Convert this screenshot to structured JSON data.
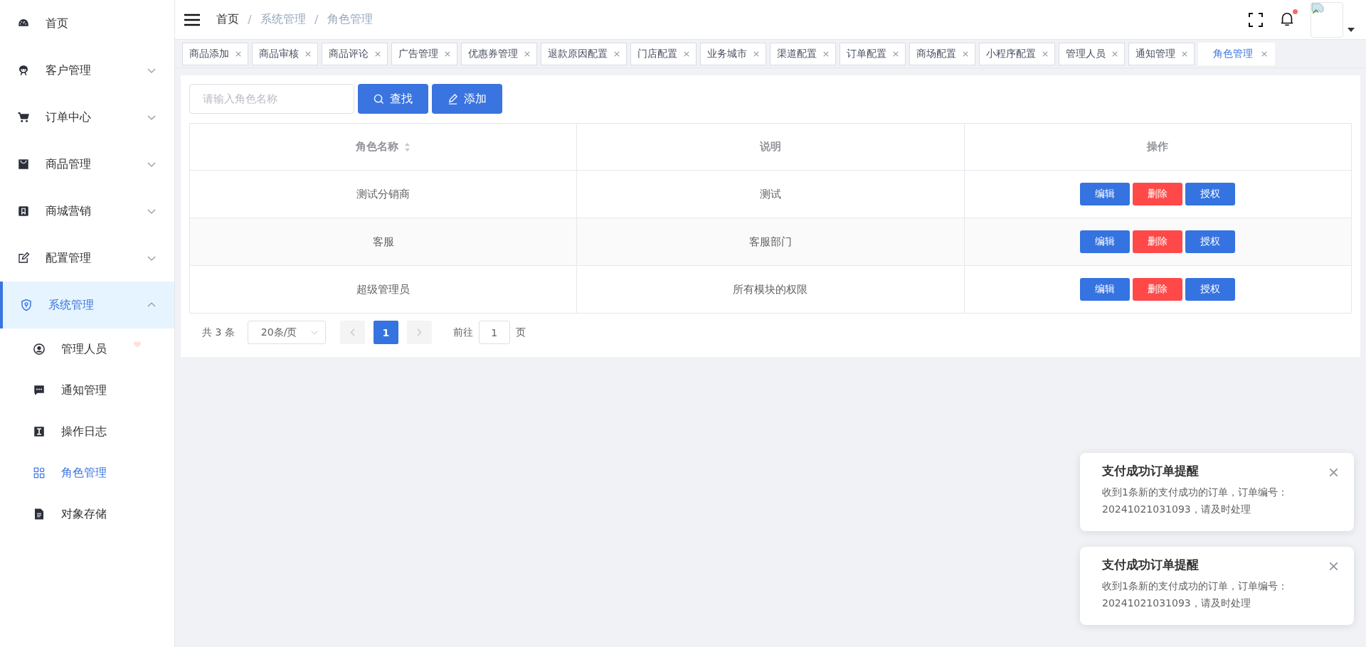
{
  "sidebar": {
    "items": [
      {
        "label": "首页",
        "kind": "link",
        "selected": false
      },
      {
        "label": "客户管理",
        "kind": "group",
        "expanded": false,
        "selected": false
      },
      {
        "label": "订单中心",
        "kind": "group",
        "expanded": false,
        "selected": false
      },
      {
        "label": "商品管理",
        "kind": "group",
        "expanded": false,
        "selected": false
      },
      {
        "label": "商城营销",
        "kind": "group",
        "expanded": false,
        "selected": false
      },
      {
        "label": "配置管理",
        "kind": "group",
        "expanded": false,
        "selected": false
      },
      {
        "label": "系统管理",
        "kind": "group",
        "expanded": true,
        "selected": true,
        "children": [
          {
            "label": "管理人员",
            "selected": false,
            "marked": true
          },
          {
            "label": "通知管理",
            "selected": false,
            "marked": false
          },
          {
            "label": "操作日志",
            "selected": false,
            "marked": false
          },
          {
            "label": "角色管理",
            "selected": true,
            "marked": false
          },
          {
            "label": "对象存储",
            "selected": false,
            "marked": false
          }
        ]
      }
    ]
  },
  "header": {
    "breadcrumb": [
      "首页",
      "系统管理",
      "角色管理"
    ],
    "separator": "/",
    "has_unread": true
  },
  "tabs": [
    {
      "label": "商品添加",
      "selected": false
    },
    {
      "label": "商品审核",
      "selected": false
    },
    {
      "label": "商品评论",
      "selected": false
    },
    {
      "label": "广告管理",
      "selected": false
    },
    {
      "label": "优惠券管理",
      "selected": false
    },
    {
      "label": "退款原因配置",
      "selected": false
    },
    {
      "label": "门店配置",
      "selected": false
    },
    {
      "label": "业务城市",
      "selected": false
    },
    {
      "label": "渠道配置",
      "selected": false
    },
    {
      "label": "订单配置",
      "selected": false
    },
    {
      "label": "商场配置",
      "selected": false
    },
    {
      "label": "小程序配置",
      "selected": false
    },
    {
      "label": "管理人员",
      "selected": false
    },
    {
      "label": "通知管理",
      "selected": false
    },
    {
      "label": "角色管理",
      "selected": true
    }
  ],
  "toolbar": {
    "search": {
      "placeholder": "请输入角色名称"
    },
    "buttons": [
      {
        "label": "查找",
        "kind": "search"
      },
      {
        "label": "添加",
        "kind": "add"
      }
    ]
  },
  "table": {
    "columns": [
      {
        "label": "角色名称",
        "sortable": true
      },
      {
        "label": "说明",
        "sortable": false
      },
      {
        "label": "操作",
        "sortable": false
      }
    ],
    "rows": [
      {
        "name": "测试分销商",
        "description": "测试",
        "actions": [
          {
            "label": "编辑",
            "kind": "primary"
          },
          {
            "label": "删除",
            "kind": "danger"
          },
          {
            "label": "授权",
            "kind": "primary"
          }
        ]
      },
      {
        "name": "客服",
        "description": "客服部门",
        "actions": [
          {
            "label": "编辑",
            "kind": "primary"
          },
          {
            "label": "删除",
            "kind": "danger"
          },
          {
            "label": "授权",
            "kind": "primary"
          }
        ]
      },
      {
        "name": "超级管理员",
        "description": "所有模块的权限",
        "actions": [
          {
            "label": "编辑",
            "kind": "primary"
          },
          {
            "label": "删除",
            "kind": "danger"
          },
          {
            "label": "授权",
            "kind": "primary"
          }
        ]
      }
    ]
  },
  "pagination": {
    "total": "共 3 条",
    "page_size": "20条/页",
    "prev_disabled": true,
    "next_disabled": true,
    "pages": [
      {
        "label": "1",
        "selected": true
      }
    ],
    "goto_label": "前往",
    "goto_value": "1",
    "goto_suffix": "页"
  },
  "notifications": [
    {
      "title": "支付成功订单提醒",
      "message": "收到1条新的支付成功的订单，订单编号：20241021031093，请及时处理"
    },
    {
      "title": "支付成功订单提醒",
      "message": "收到1条新的支付成功的订单，订单编号：20241021031093，请及时处理"
    }
  ]
}
